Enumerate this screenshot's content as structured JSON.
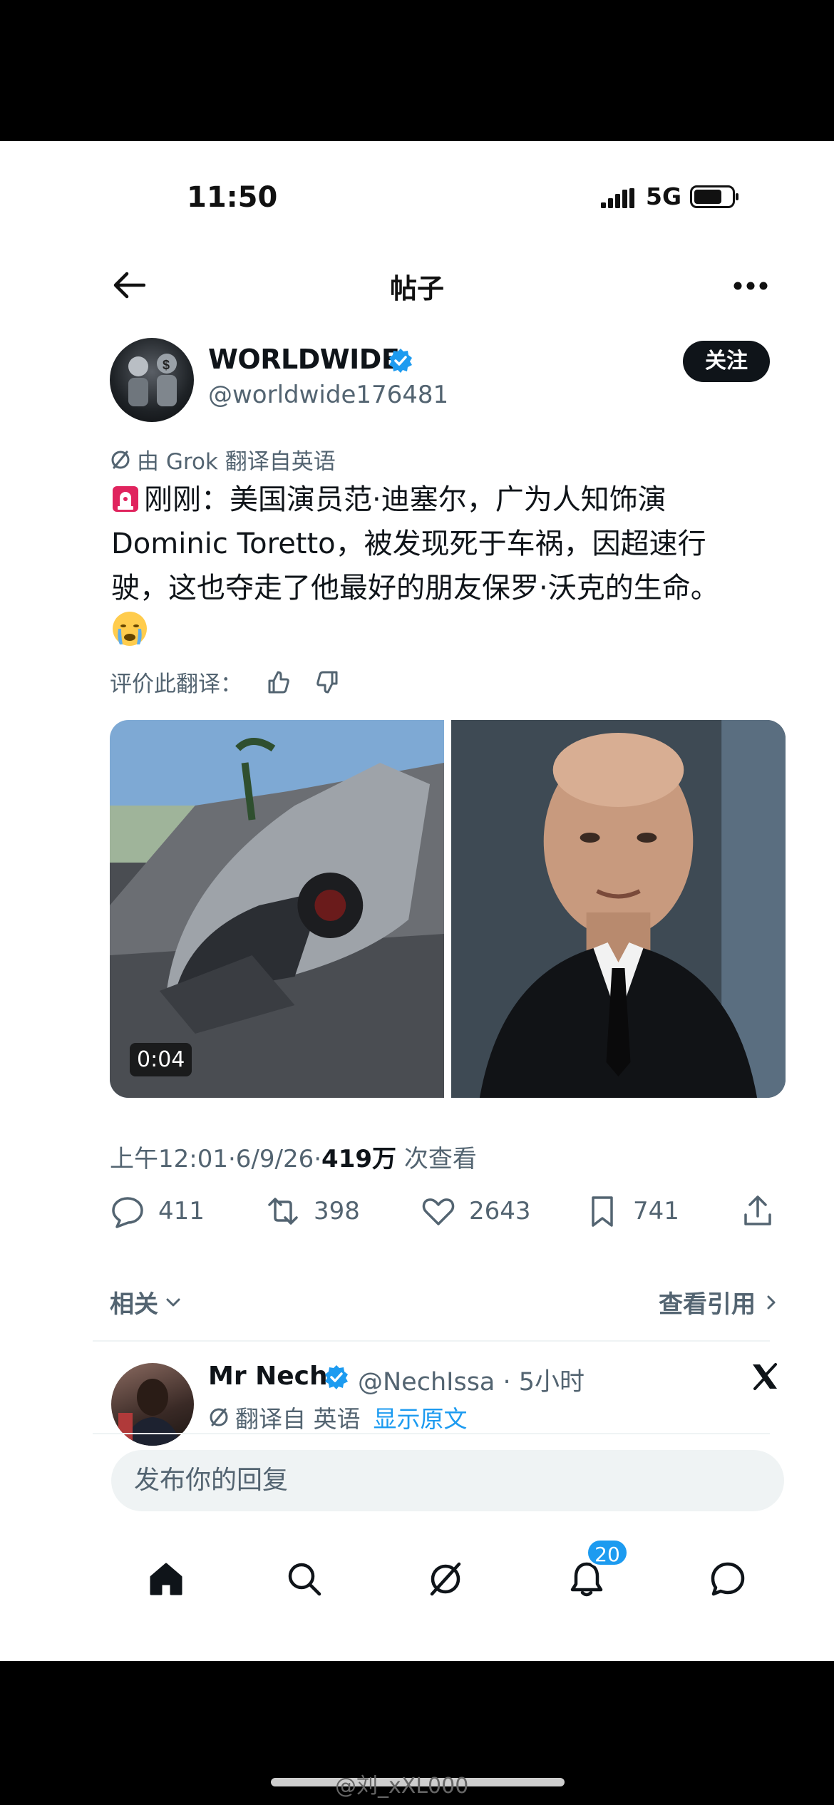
{
  "status_bar": {
    "time": "11:50",
    "network": "5G"
  },
  "header": {
    "title": "帖子",
    "back_icon": "arrow-left-icon",
    "more_icon": "ellipsis-icon"
  },
  "author": {
    "name": "WORLDWIDE",
    "handle": "@worldwide176481",
    "follow_label": "关注"
  },
  "translation_note": "由 Grok 翻译自英语",
  "tweet": {
    "line1": "刚刚：美国演员范·迪塞尔，广为人知饰演",
    "line2": "Dominic Toretto，被发现死于车祸，因超速行",
    "line3": "驶，这也夺走了他最好的朋友保罗·沃克的生命。"
  },
  "rate_translation_label": "评价此翻译：",
  "media": {
    "video_duration": "0:04"
  },
  "meta": {
    "time": "上午12:01",
    "date": "6/9/26",
    "views": "419万",
    "views_suffix": "次查看",
    "sep": "·"
  },
  "actions": {
    "replies": "411",
    "reposts": "398",
    "likes": "2643",
    "bookmarks": "741"
  },
  "related_label": "相关",
  "view_quotes_label": "查看引用",
  "reply": {
    "name": "Mr Nech",
    "handle": "@NechIssa · 5小时",
    "translate": "翻译自 英语",
    "show_original": "显示原文"
  },
  "composer_placeholder": "发布你的回复",
  "nav": {
    "notifications_badge": "20"
  },
  "watermark": "@刘_xXL000",
  "colors": {
    "accent": "#1d9bf0",
    "text": "#0f1419",
    "muted": "#536471"
  }
}
